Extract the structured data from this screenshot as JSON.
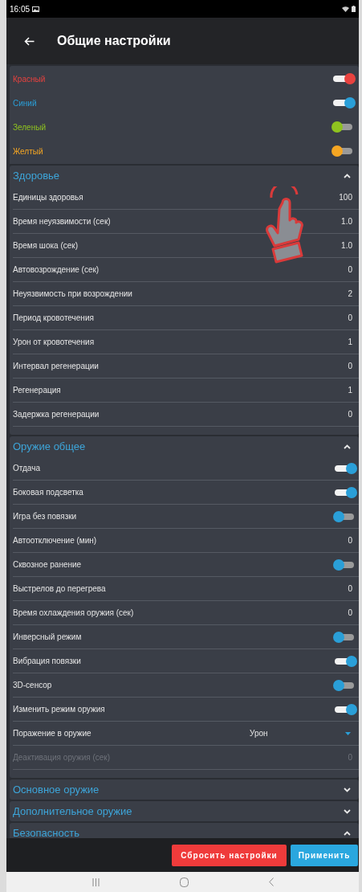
{
  "status_bar": {
    "time": "16:05"
  },
  "app_bar": {
    "title": "Общие настройки"
  },
  "color_toggles": [
    {
      "label": "Красный",
      "color": "#e8423f",
      "on": true
    },
    {
      "label": "Синий",
      "color": "#2a9fd8",
      "on": true
    },
    {
      "label": "Зеленый",
      "color": "#8fc31f",
      "on": false
    },
    {
      "label": "Желтый",
      "color": "#f5a623",
      "on": false
    }
  ],
  "sections": [
    {
      "title": "Здоровье",
      "expanded": true,
      "rows": [
        {
          "kind": "value",
          "label": "Единицы здоровья",
          "value": "100",
          "disabled": false
        },
        {
          "kind": "value",
          "label": "Время неуязвимости (сек)",
          "value": "1.0",
          "disabled": false
        },
        {
          "kind": "value",
          "label": "Время шока (сек)",
          "value": "1.0",
          "disabled": false
        },
        {
          "kind": "value",
          "label": "Автовозрождение (сек)",
          "value": "0",
          "disabled": false
        },
        {
          "kind": "value",
          "label": "Неуязвимость при возрождении",
          "value": "2",
          "disabled": false
        },
        {
          "kind": "value",
          "label": "Период кровотечения",
          "value": "0",
          "disabled": false
        },
        {
          "kind": "value",
          "label": "Урон от кровотечения",
          "value": "1",
          "disabled": false
        },
        {
          "kind": "value",
          "label": "Интервал регенерации",
          "value": "0",
          "disabled": false
        },
        {
          "kind": "value",
          "label": "Регенерация",
          "value": "1",
          "disabled": false
        },
        {
          "kind": "value",
          "label": "Задержка регенерации",
          "value": "0",
          "disabled": false
        }
      ]
    },
    {
      "title": "Оружие общее",
      "expanded": true,
      "rows": [
        {
          "kind": "toggle",
          "label": "Отдача",
          "on": true,
          "disabled": false
        },
        {
          "kind": "toggle",
          "label": "Боковая подсветка",
          "on": true,
          "disabled": false
        },
        {
          "kind": "toggle",
          "label": "Игра без повязки",
          "on": false,
          "disabled": false
        },
        {
          "kind": "value",
          "label": "Автоотключение (мин)",
          "value": "0",
          "disabled": false
        },
        {
          "kind": "toggle",
          "label": "Сквозное ранение",
          "on": false,
          "disabled": false
        },
        {
          "kind": "value",
          "label": "Выстрелов до перегрева",
          "value": "0",
          "disabled": false
        },
        {
          "kind": "value",
          "label": "Время охлаждения оружия (сек)",
          "value": "0",
          "disabled": false
        },
        {
          "kind": "toggle",
          "label": "Инверсный режим",
          "on": false,
          "disabled": false
        },
        {
          "kind": "toggle",
          "label": "Вибрация повязки",
          "on": true,
          "disabled": false
        },
        {
          "kind": "toggle",
          "label": "3D-сенсор",
          "on": false,
          "disabled": false
        },
        {
          "kind": "toggle",
          "label": "Изменить режим оружия",
          "on": true,
          "disabled": false
        },
        {
          "kind": "dropdown",
          "label": "Поражение в оружие",
          "value": "Урон",
          "disabled": false
        },
        {
          "kind": "value",
          "label": "Деактивация оружия (сек)",
          "value": "0",
          "disabled": true
        }
      ]
    },
    {
      "title": "Основное оружие",
      "expanded": false
    },
    {
      "title": "Дополнительное оружие",
      "expanded": false
    },
    {
      "title": "Безопасность",
      "expanded": true
    }
  ],
  "buttons": [
    {
      "kind": "reset",
      "label": "Сбросить настройки"
    },
    {
      "kind": "apply",
      "label": "Применить"
    }
  ]
}
